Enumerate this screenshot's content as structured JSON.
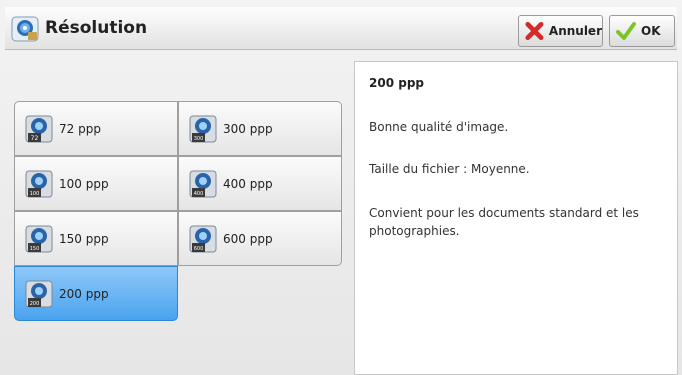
{
  "header": {
    "title": "Résolution",
    "cancel_label": "Annuler",
    "ok_label": "OK"
  },
  "options": [
    {
      "label": "72 ppp",
      "badge": "72"
    },
    {
      "label": "300 ppp",
      "badge": "300"
    },
    {
      "label": "100 ppp",
      "badge": "100"
    },
    {
      "label": "400 ppp",
      "badge": "400"
    },
    {
      "label": "150 ppp",
      "badge": "150"
    },
    {
      "label": "600 ppp",
      "badge": "600"
    },
    {
      "label": "200 ppp",
      "badge": "200"
    }
  ],
  "selected": "200 ppp",
  "description": {
    "title": "200 ppp",
    "line1": "Bonne qualité d'image.",
    "line2": "Taille du fichier : Moyenne.",
    "line3": "Convient pour les documents standard et les photographies."
  },
  "colors": {
    "selected_top": "#8ec8f8",
    "selected_bottom": "#4aa3ee",
    "cancel_x": "#d42a2a",
    "ok_check": "#7cc42a"
  },
  "icons": {
    "title": "resolution-icon",
    "cancel": "red-x-icon",
    "ok": "green-check-icon",
    "option": "resolution-dots-icon"
  }
}
